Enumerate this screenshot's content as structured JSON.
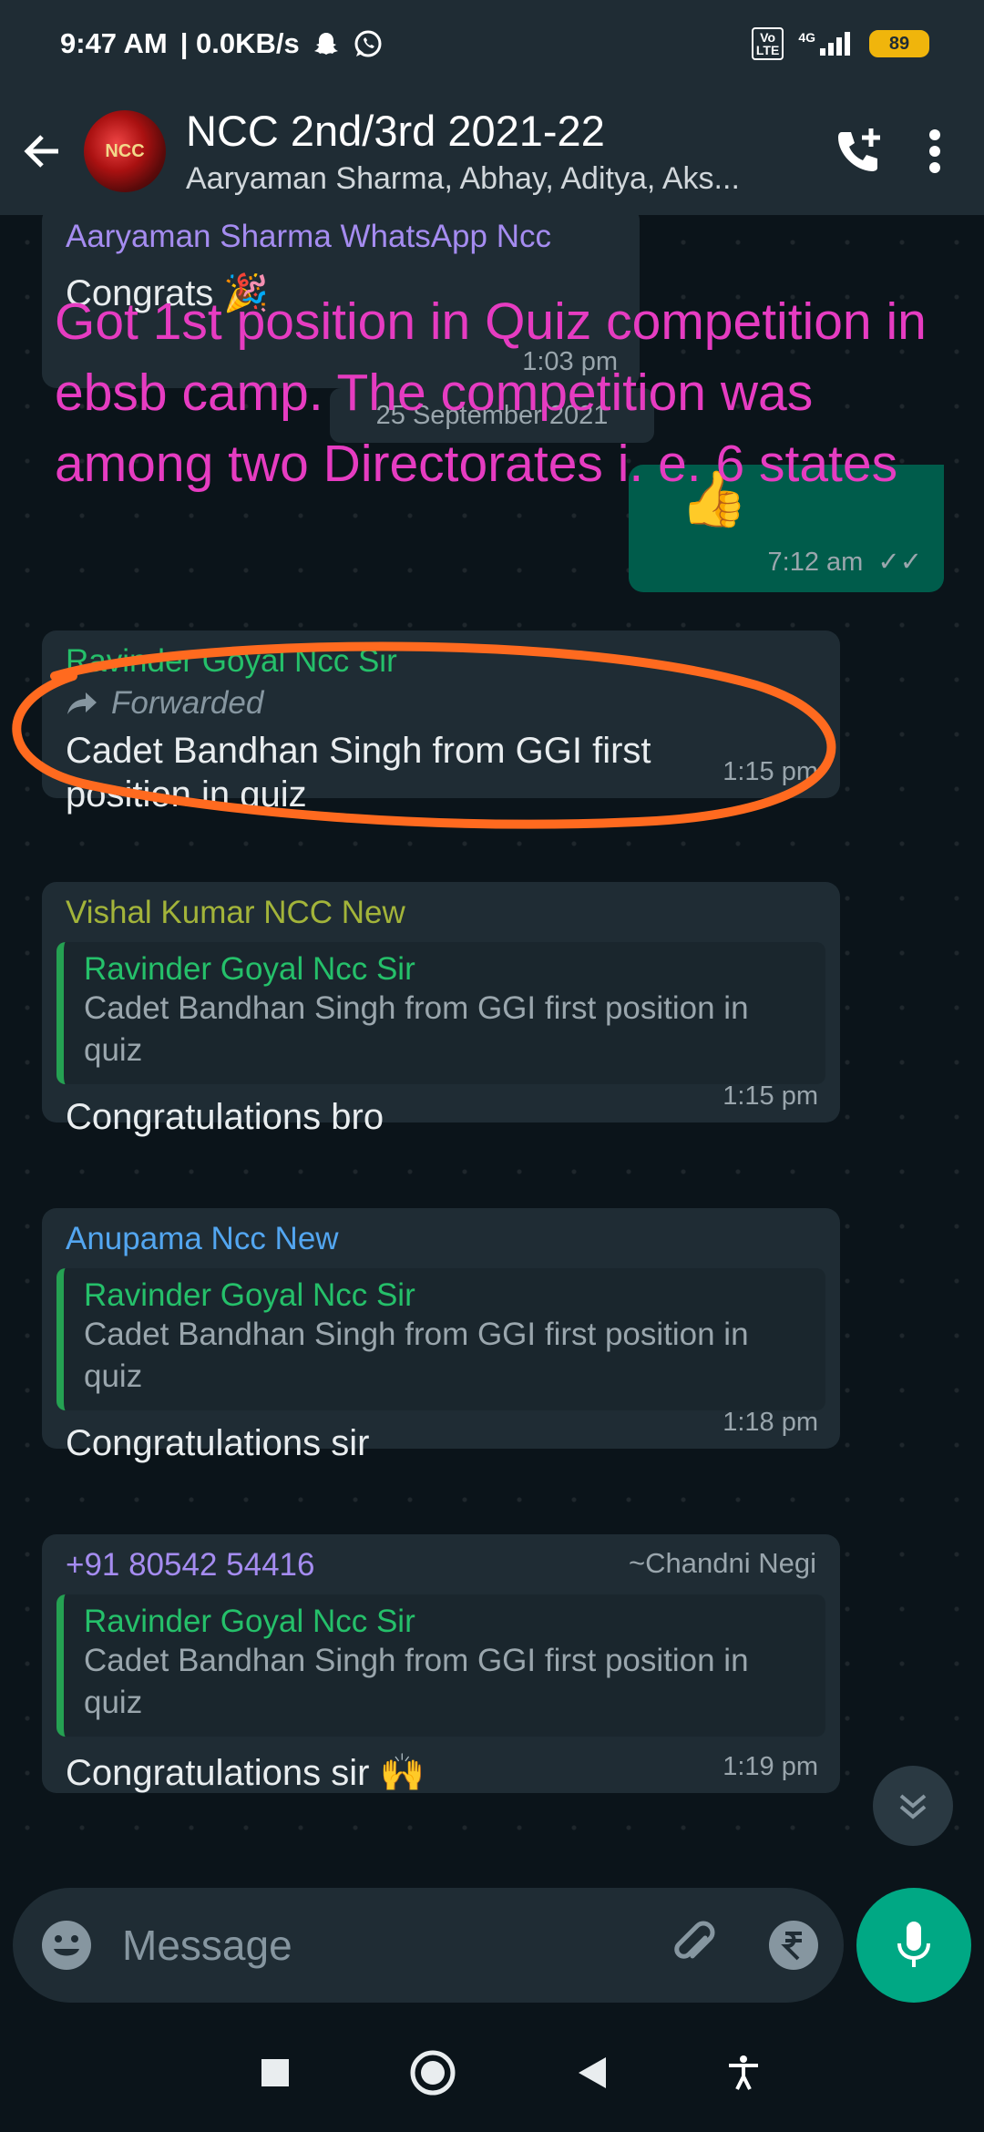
{
  "status_bar": {
    "time": "9:47 AM",
    "net_speed": "| 0.0KB/s",
    "volte_label": "Vo\nLTE",
    "network": "4G",
    "battery": "89"
  },
  "header": {
    "title": "NCC 2nd/3rd 2021-22",
    "participants": "Aaryaman Sharma, Abhay, Aditya, Aks...",
    "avatar_label": "NCC"
  },
  "annotation_text": "Got 1st position in Quiz competition in ebsb camp. The competition was among two Directorates  i. e. 6 states",
  "date_chip": "25 September 2021",
  "messages": [
    {
      "sender": "Aaryaman Sharma WhatsApp Ncc",
      "sender_color": "#a58cf0",
      "text": "Congrats 🎉",
      "time": "1:03 pm"
    },
    {
      "outgoing": true,
      "text": "👍",
      "time": "7:12 am",
      "ticks": "✓✓"
    },
    {
      "sender": "Ravinder Goyal Ncc Sir",
      "sender_color": "#25c06a",
      "forwarded_label": "Forwarded",
      "text": "Cadet Bandhan Singh from GGI first position in quiz",
      "time": "1:15 pm"
    },
    {
      "sender": "Vishal Kumar NCC New",
      "sender_color": "#a3b43a",
      "quote_name": "Ravinder Goyal Ncc Sir",
      "quote_text": "Cadet Bandhan Singh from GGI first position in quiz",
      "text": "Congratulations bro",
      "time": "1:15 pm"
    },
    {
      "sender": "Anupama Ncc New",
      "sender_color": "#53a6f0",
      "quote_name": "Ravinder Goyal Ncc Sir",
      "quote_text": "Cadet Bandhan Singh from GGI first position in quiz",
      "text": "Congratulations sir",
      "time": "1:18 pm"
    },
    {
      "sender": "+91 80542 54416",
      "sender_color": "#a58cf0",
      "push_name": "~Chandni Negi",
      "quote_name": "Ravinder Goyal Ncc Sir",
      "quote_text": "Cadet Bandhan Singh from GGI first position in quiz",
      "text": "Congratulations sir 🙌",
      "time": "1:19 pm"
    }
  ],
  "composer": {
    "placeholder": "Message"
  },
  "colors": {
    "annotation": "#e63cc1",
    "highlight_circle": "#ff6a1f",
    "accent": "#00a884"
  }
}
